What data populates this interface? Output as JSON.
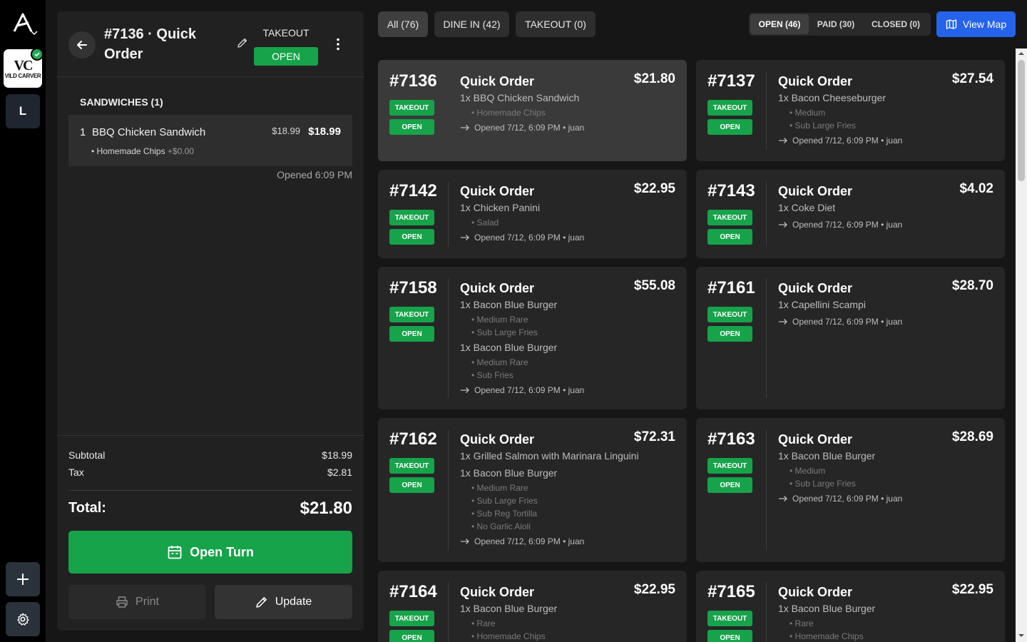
{
  "rail": {
    "store_mark": "VC",
    "store_text": "VILD CARVER",
    "user_initial": "L"
  },
  "detail": {
    "title": "#7136 · Quick Order",
    "order_type": "TAKEOUT",
    "status": "OPEN",
    "section": "SANDWICHES (1)",
    "item": {
      "qty": "1",
      "name": "BBQ Chicken Sandwich",
      "unit_price": "$18.99",
      "total": "$18.99",
      "modifier": "• Homemade Chips",
      "modifier_price": "+$0.00"
    },
    "opened": "Opened 6:09 PM",
    "subtotal_label": "Subtotal",
    "subtotal": "$18.99",
    "tax_label": "Tax",
    "tax": "$2.81",
    "total_label": "Total:",
    "total": "$21.80",
    "open_turn_label": "Open Turn",
    "print_label": "Print",
    "update_label": "Update"
  },
  "filters": {
    "all": "All (76)",
    "dine_in": "DINE IN (42)",
    "takeout": "TAKEOUT (0)"
  },
  "status_tabs": {
    "open": "OPEN (46)",
    "paid": "PAID (30)",
    "closed": "CLOSED (0)"
  },
  "view_map_label": "View Map",
  "colors": {
    "accent_green": "#16a34a",
    "accent_blue": "#2563eb"
  },
  "orders": [
    {
      "num": "#7136",
      "type": "TAKEOUT",
      "status": "OPEN",
      "title": "Quick Order",
      "price": "$21.80",
      "items": [
        {
          "line": "1x BBQ Chicken Sandwich",
          "mods": [
            "• Homemade Chips"
          ]
        }
      ],
      "opened": "Opened 7/12, 6:09 PM • juan"
    },
    {
      "num": "#7137",
      "type": "TAKEOUT",
      "status": "OPEN",
      "title": "Quick Order",
      "price": "$27.54",
      "items": [
        {
          "line": "1x Bacon Cheeseburger",
          "mods": [
            "• Medium",
            "• Sub Large Fries"
          ]
        }
      ],
      "opened": "Opened 7/12, 6:09 PM • juan"
    },
    {
      "num": "#7142",
      "type": "TAKEOUT",
      "status": "OPEN",
      "title": "Quick Order",
      "price": "$22.95",
      "items": [
        {
          "line": "1x Chicken Panini",
          "mods": [
            "• Salad"
          ]
        }
      ],
      "opened": "Opened 7/12, 6:09 PM • juan"
    },
    {
      "num": "#7143",
      "type": "TAKEOUT",
      "status": "OPEN",
      "title": "Quick Order",
      "price": "$4.02",
      "items": [
        {
          "line": "1x Coke Diet",
          "mods": []
        }
      ],
      "opened": "Opened 7/12, 6:09 PM • juan"
    },
    {
      "num": "#7158",
      "type": "TAKEOUT",
      "status": "OPEN",
      "title": "Quick Order",
      "price": "$55.08",
      "items": [
        {
          "line": "1x Bacon Blue Burger",
          "mods": [
            "• Medium Rare",
            "• Sub Large Fries"
          ]
        },
        {
          "line": "1x Bacon Blue Burger",
          "mods": [
            "• Medium Rare",
            "• Sub Fries"
          ]
        }
      ],
      "opened": "Opened 7/12, 6:09 PM • juan"
    },
    {
      "num": "#7161",
      "type": "TAKEOUT",
      "status": "OPEN",
      "title": "Quick Order",
      "price": "$28.70",
      "items": [
        {
          "line": "1x Capellini Scampi",
          "mods": []
        }
      ],
      "opened": "Opened 7/12, 6:09 PM • juan"
    },
    {
      "num": "#7162",
      "type": "TAKEOUT",
      "status": "OPEN",
      "title": "Quick Order",
      "price": "$72.31",
      "items": [
        {
          "line": "1x Grilled Salmon with Marinara Linguini",
          "mods": []
        },
        {
          "line": "1x Bacon Blue Burger",
          "mods": [
            "• Medium Rare",
            "• Sub Large Fries",
            "• Sub Reg Tortilla",
            "• No Garlic Aioli"
          ]
        }
      ],
      "opened": "Opened 7/12, 6:09 PM • juan"
    },
    {
      "num": "#7163",
      "type": "TAKEOUT",
      "status": "OPEN",
      "title": "Quick Order",
      "price": "$28.69",
      "items": [
        {
          "line": "1x Bacon Blue Burger",
          "mods": [
            "• Medium",
            "• Sub Large Fries"
          ]
        }
      ],
      "opened": "Opened 7/12, 6:09 PM • juan"
    },
    {
      "num": "#7164",
      "type": "TAKEOUT",
      "status": "OPEN",
      "title": "Quick Order",
      "price": "$22.95",
      "items": [
        {
          "line": "1x Bacon Blue Burger",
          "mods": [
            "• Rare",
            "• Homemade Chips"
          ]
        }
      ],
      "opened": ""
    },
    {
      "num": "#7165",
      "type": "TAKEOUT",
      "status": "OPEN",
      "title": "Quick Order",
      "price": "$22.95",
      "items": [
        {
          "line": "1x Bacon Blue Burger",
          "mods": [
            "• Rare",
            "• Homemade Chips"
          ]
        }
      ],
      "opened": ""
    }
  ]
}
